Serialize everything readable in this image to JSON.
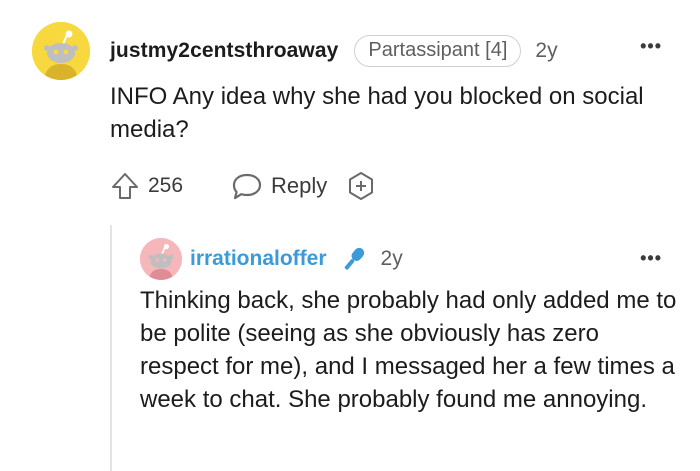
{
  "comment": {
    "username": "justmy2centsthroaway",
    "flair": "Partassipant [4]",
    "timestamp": "2y",
    "more_label": "•••",
    "body": "INFO Any idea why she had you blocked on social media?",
    "votes": "256",
    "reply_label": "Reply",
    "avatar_icon": "snoo-avatar-icon",
    "avatar_color": "#f8d83f"
  },
  "reply": {
    "username": "irrationaloffer",
    "timestamp": "2y",
    "more_label": "•••",
    "body": "Thinking back, she probably had only added me to be polite (seeing as she obviously has zero respect for me), and I messaged her a few times a week to chat. She probably found me annoying.",
    "username_color": "#3d9ad9",
    "badge_icon": "microphone-icon",
    "avatar_color": "#f6b7bb"
  }
}
